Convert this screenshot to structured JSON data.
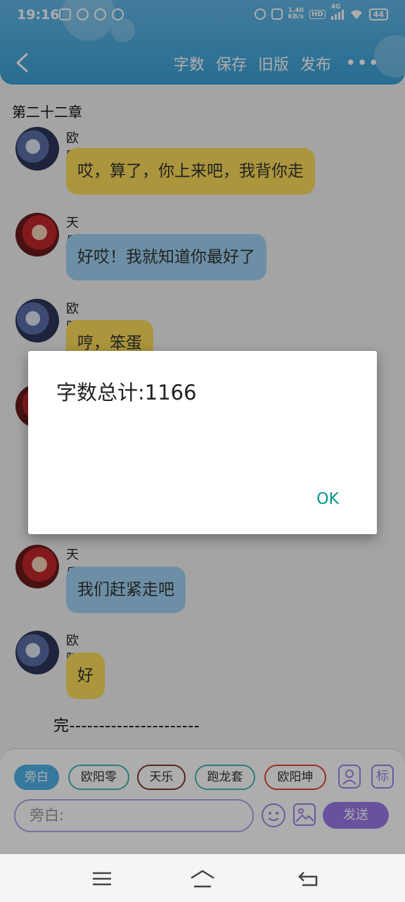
{
  "status_bar": {
    "time": "19:16",
    "net_speed_value": "1.40",
    "net_speed_unit": "KB/s",
    "hd_label": "HD",
    "network_label": "4G",
    "battery": "44"
  },
  "header": {
    "toolbar": [
      "字数",
      "保存",
      "旧版",
      "发布"
    ]
  },
  "chapter_title": "第二十二章",
  "messages": [
    {
      "speaker": "欧阳零",
      "text": "哎，算了，你上来吧，我背你走"
    },
    {
      "speaker": "天乐",
      "text": "好哎！我就知道你最好了"
    },
    {
      "speaker": "欧阳零",
      "text": "哼，笨蛋"
    },
    {
      "speaker": "天乐",
      "text": "我们赶紧走吧"
    },
    {
      "speaker": "欧阳零",
      "text": "好"
    }
  ],
  "end_marker": "完----------------------",
  "input_panel": {
    "characters": [
      "旁白",
      "欧阳零",
      "天乐",
      "跑龙套",
      "欧阳坤"
    ],
    "tag_button": "标",
    "input_placeholder": "旁白:",
    "send_label": "发送"
  },
  "dialog": {
    "message": "字数总计:1166",
    "ok_label": "OK"
  },
  "colors": {
    "header": "#3ba1d7",
    "bubble_yellow": "#fcdc5a",
    "bubble_blue": "#9fd3f4",
    "accent_purple": "#9a7ae8",
    "dialog_ok": "#009688"
  }
}
